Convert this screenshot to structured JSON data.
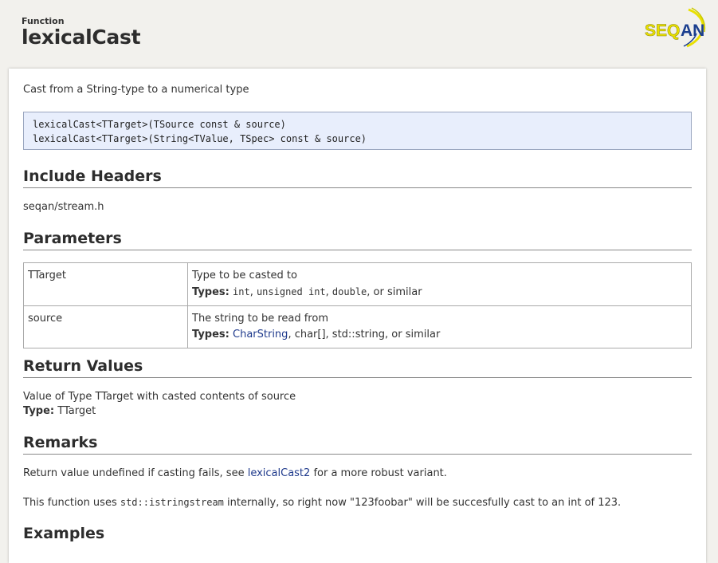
{
  "header": {
    "kind": "Function",
    "title": "lexicalCast",
    "logo_text": "SEQAN"
  },
  "summary": "Cast from a String-type to a numerical type",
  "signatures": [
    "lexicalCast<TTarget>(TSource const & source)",
    "lexicalCast<TTarget>(String<TValue, TSpec> const & source)"
  ],
  "include_headers": {
    "heading": "Include Headers",
    "value": "seqan/stream.h"
  },
  "parameters": {
    "heading": "Parameters",
    "rows": [
      {
        "name": "TTarget",
        "description": "Type to be casted to",
        "types_label": "Types:",
        "types": [
          {
            "text": "int",
            "mono": true
          },
          {
            "text": ", ",
            "mono": false
          },
          {
            "text": "unsigned int",
            "mono": true
          },
          {
            "text": ", ",
            "mono": false
          },
          {
            "text": "double",
            "mono": true
          },
          {
            "text": ", or similar",
            "mono": false
          }
        ]
      },
      {
        "name": "source",
        "description": "The string to be read from",
        "types_label": "Types:",
        "types": [
          {
            "text": "CharString",
            "link": true
          },
          {
            "text": ", char[], std::string, or similar",
            "mono": false
          }
        ]
      }
    ]
  },
  "return_values": {
    "heading": "Return Values",
    "description": "Value of Type TTarget with casted contents of source",
    "type_label": "Type:",
    "type_value": "TTarget"
  },
  "remarks": {
    "heading": "Remarks",
    "line1_before": "Return value undefined if casting fails, see ",
    "line1_link": "lexicalCast2",
    "line1_after": " for a more robust variant.",
    "line2_before": "This function uses ",
    "line2_code": "std::istringstream",
    "line2_after": " internally, so right now \"123foobar\" will be succesfully cast to an int of 123."
  },
  "examples": {
    "heading": "Examples"
  },
  "colors": {
    "link": "#1f3a8c",
    "logo_yellow": "#e9e000",
    "logo_blue": "#1c3f8f",
    "signature_bg": "#e8eefc"
  }
}
